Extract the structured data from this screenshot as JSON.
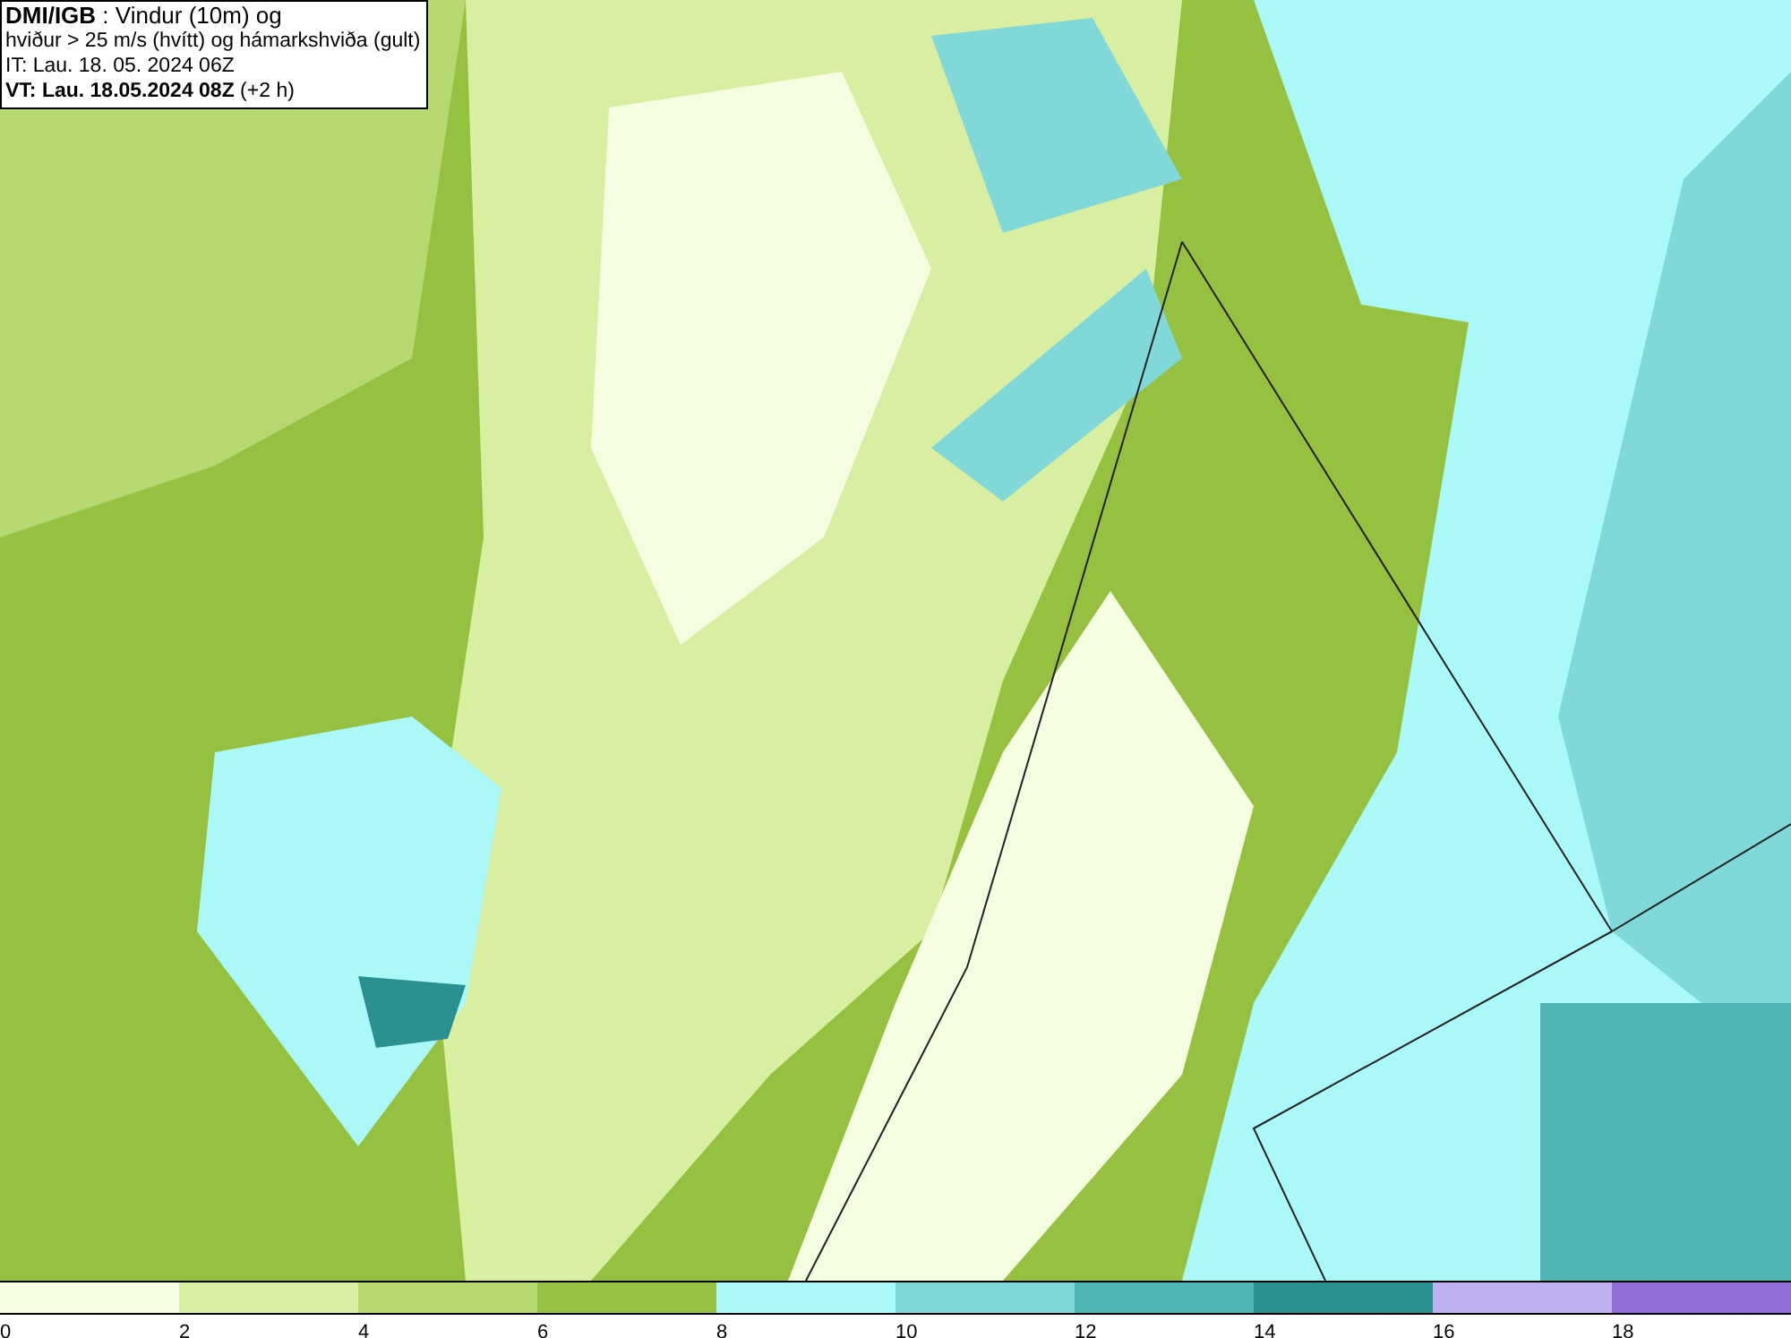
{
  "legend": {
    "lines": [
      "**DMI/IGB** : Vindur (10m) og",
      "hviður > 25 m/s (hvítt) og hámarkshviða (gult)",
      "IT: Lau. 18. 05. 2024 06Z",
      "**VT: Lau. 18.05.2024 08Z** (+2 h)"
    ]
  },
  "colorbar": {
    "segments": [
      {
        "color": "#f5fde0"
      },
      {
        "color": "#d8eea0"
      },
      {
        "color": "#b5d870"
      },
      {
        "color": "#96c040"
      },
      {
        "color": "#aaf8f8"
      },
      {
        "color": "#80d8d8"
      },
      {
        "color": "#50b4b4"
      },
      {
        "color": "#2a9090"
      },
      {
        "color": "#c0b0f0"
      },
      {
        "color": "#9070d8"
      }
    ],
    "ticks": [
      "0",
      "2",
      "4",
      "6",
      "8",
      "10",
      "12",
      "14",
      "16",
      "18"
    ]
  }
}
